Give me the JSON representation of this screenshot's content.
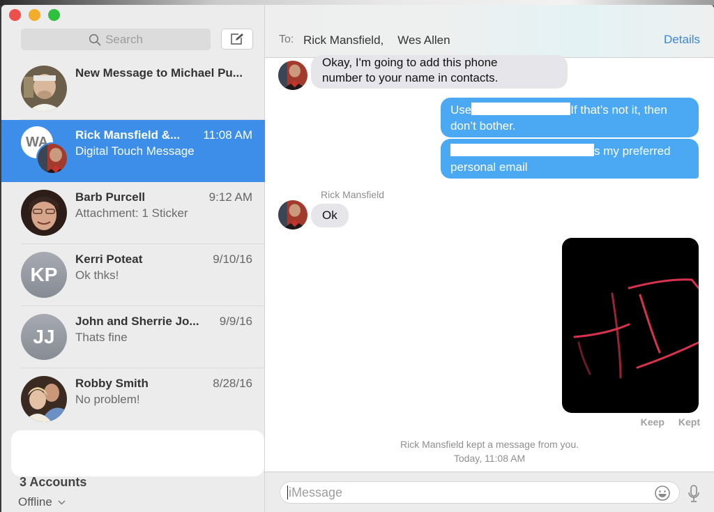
{
  "window": {
    "traffic_lights": [
      "close",
      "minimize",
      "maximize"
    ],
    "colors": {
      "close": "#ee4f4b",
      "minimize": "#f2ae2a",
      "maximize": "#2ec13e",
      "selected": "#3d8ee9",
      "outgoing": "#4aa9f2",
      "link": "#3b86d8"
    }
  },
  "sidebar": {
    "search": {
      "placeholder": "Search",
      "icon": "search-icon"
    },
    "compose_icon": "compose-icon",
    "conversations": [
      {
        "name": "New Message to Michael Pu...",
        "time": "",
        "preview": "",
        "avatar": "photo"
      },
      {
        "name": "Rick Mansfield &...",
        "time": "11:08 AM",
        "preview": "Digital Touch Message",
        "avatar": "group",
        "group_initials": "WA",
        "selected": true
      },
      {
        "name": "Barb Purcell",
        "time": "9:12 AM",
        "preview": "Attachment: 1 Sticker",
        "avatar": "photo"
      },
      {
        "name": "Kerri Poteat",
        "time": "9/10/16",
        "preview": "Ok thks!",
        "avatar": "initials",
        "initials": "KP"
      },
      {
        "name": "John and Sherrie Jo...",
        "time": "9/9/16",
        "preview": "Thats fine",
        "avatar": "initials",
        "initials": "JJ"
      },
      {
        "name": "Robby Smith",
        "time": "8/28/16",
        "preview": "No problem!",
        "avatar": "photo"
      }
    ],
    "accounts_label": "3 Accounts",
    "status_label": "Offline"
  },
  "header": {
    "to_label": "To:",
    "recipients": [
      "Rick Mansfield,",
      "Wes Allen"
    ],
    "details_label": "Details"
  },
  "messages": [
    {
      "direction": "in",
      "text_line1": "Okay, I'm going to add this phone",
      "text_line2": "number to your name in contacts."
    },
    {
      "direction": "out",
      "prefix": "Use",
      "suffix": "If that’s not it, then",
      "line2": "don’t bother.",
      "redacted": true
    },
    {
      "direction": "out",
      "suffix": "s my preferred",
      "line2": "personal email",
      "redacted": true
    },
    {
      "direction": "in",
      "sender": "Rick Mansfield",
      "text": "Ok"
    },
    {
      "direction": "out",
      "type": "digital-touch",
      "actions": [
        "Keep",
        "Kept"
      ]
    }
  ],
  "status_note": {
    "line1": "Rick Mansfield kept a message from you.",
    "line2": "Today, 11:08 AM"
  },
  "composer": {
    "placeholder": "iMessage",
    "emoji_icon": "emoji-icon",
    "mic_icon": "microphone-icon"
  }
}
